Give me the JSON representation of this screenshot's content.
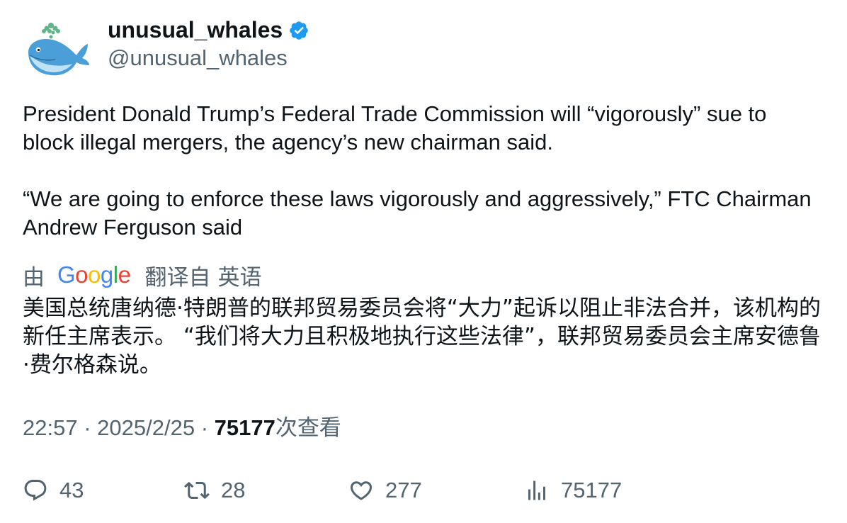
{
  "author": {
    "display_name": "unusual_whales",
    "handle": "@unusual_whales",
    "verified": true,
    "avatar_icon": "whale-avatar-icon",
    "verified_color": "#1d9bf0"
  },
  "tweet": {
    "paragraph1": "President Donald Trump’s Federal Trade Commission will “vigorously” sue to block illegal mergers, the agency’s new chairman said.",
    "paragraph2": "“We are going to enforce these laws vigorously and aggressively,” FTC Chairman Andrew Ferguson said"
  },
  "translation_bar": {
    "by": "由",
    "provider": "Google",
    "translated_from": "翻译自",
    "language": "英语"
  },
  "translation_text": "美国总统唐纳德·特朗普的联邦贸易委员会将“大力”起诉以阻止非法合并，该机构的新任主席表示。 “我们将大力且积极地执行这些法律”，联邦贸易委员会主席安德鲁·费尔格森说。",
  "meta": {
    "time": "22:57",
    "separator": "·",
    "date": "2025/2/25",
    "views_count": "75177",
    "views_label": "次查看"
  },
  "actions": {
    "replies": "43",
    "retweets": "28",
    "likes": "277",
    "views": "75177"
  },
  "colors": {
    "text_primary": "#0f1419",
    "text_secondary": "#536471",
    "brand_blue": "#1d9bf0"
  }
}
